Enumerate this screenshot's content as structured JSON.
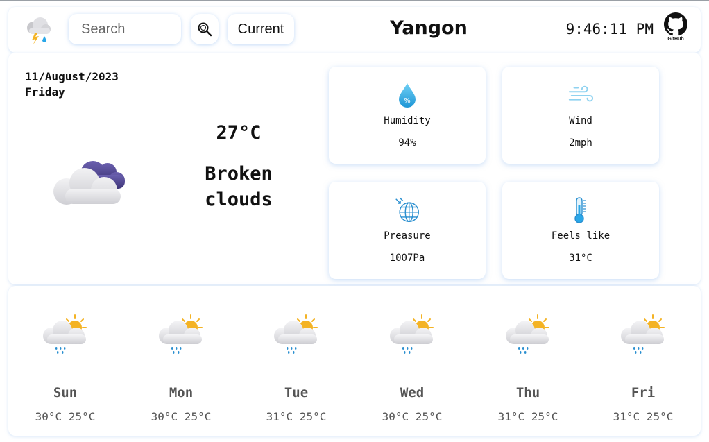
{
  "header": {
    "search_placeholder": "Search",
    "current_label": "Current",
    "city": "Yangon",
    "time": "9:46:11 PM",
    "github_label": "GitHub"
  },
  "main": {
    "date": "11/August/2023",
    "weekday": "Friday",
    "temperature": "27°C",
    "description_line1": "Broken",
    "description_line2": "clouds",
    "icon": "broken-clouds-icon",
    "cards": [
      {
        "label": "Humidity",
        "value": "94%",
        "icon": "humidity-drop-icon"
      },
      {
        "label": "Wind",
        "value": "2mph",
        "icon": "wind-icon"
      },
      {
        "label": "Preasure",
        "value": "1007Pa",
        "icon": "pressure-globe-icon"
      },
      {
        "label": "Feels like",
        "value": "31°C",
        "icon": "thermometer-icon"
      }
    ]
  },
  "forecast": [
    {
      "day": "Sun",
      "temps": "30°C 25°C",
      "icon": "sun-cloud-rain-icon"
    },
    {
      "day": "Mon",
      "temps": "30°C 25°C",
      "icon": "sun-cloud-rain-icon"
    },
    {
      "day": "Tue",
      "temps": "31°C 25°C",
      "icon": "sun-cloud-rain-icon"
    },
    {
      "day": "Wed",
      "temps": "30°C 25°C",
      "icon": "sun-cloud-rain-icon"
    },
    {
      "day": "Thu",
      "temps": "31°C 25°C",
      "icon": "sun-cloud-rain-icon"
    },
    {
      "day": "Fri",
      "temps": "31°C 25°C",
      "icon": "sun-cloud-rain-icon"
    }
  ],
  "colors": {
    "accent_blue": "#2aa7e8",
    "sun_yellow": "#f4b324",
    "cloud_purple": "#5b4f96",
    "card_shadow": "#aac8f0"
  }
}
